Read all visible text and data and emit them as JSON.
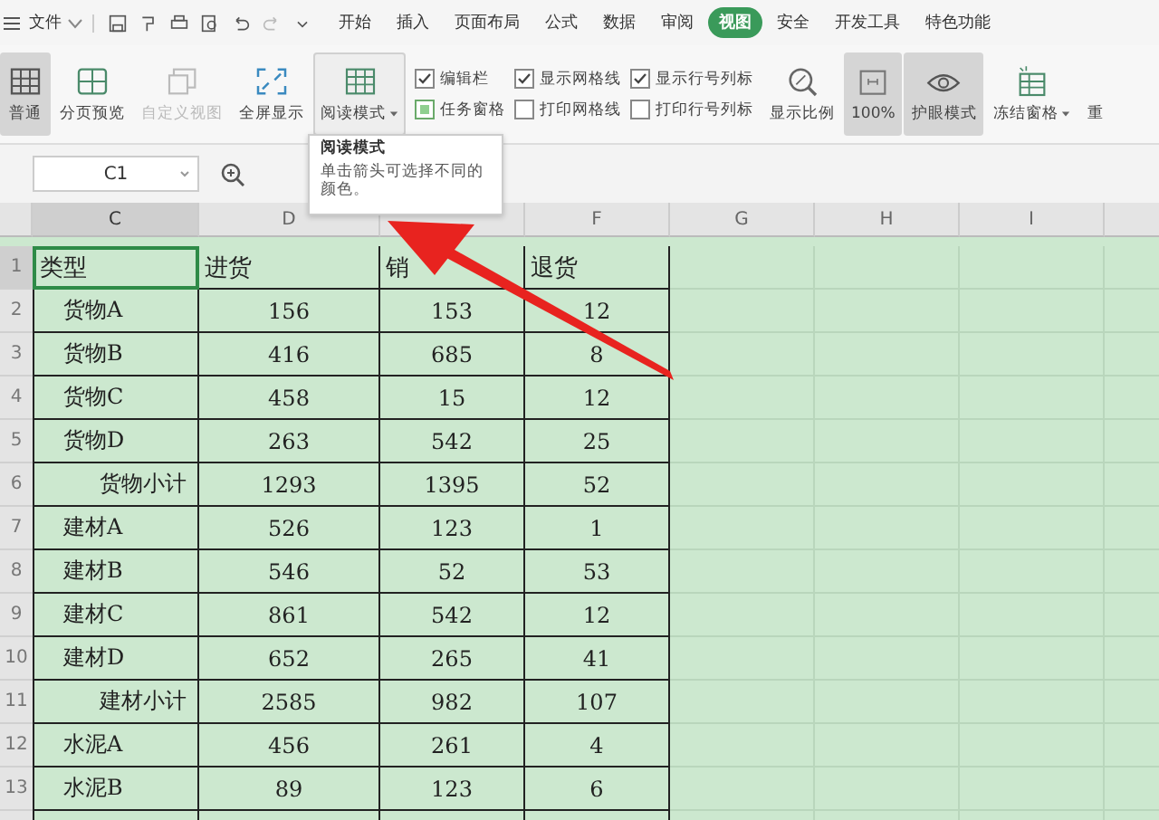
{
  "menu_bar": {
    "file_menu": "文件",
    "tabs": [
      {
        "label": "开始",
        "selected": false
      },
      {
        "label": "插入",
        "selected": false
      },
      {
        "label": "页面布局",
        "selected": false
      },
      {
        "label": "公式",
        "selected": false
      },
      {
        "label": "数据",
        "selected": false
      },
      {
        "label": "审阅",
        "selected": false
      },
      {
        "label": "视图",
        "selected": true
      },
      {
        "label": "安全",
        "selected": false
      },
      {
        "label": "开发工具",
        "selected": false
      },
      {
        "label": "特色功能",
        "selected": false
      }
    ]
  },
  "ribbon": {
    "view_buttons": [
      {
        "label": "普通",
        "selected": true,
        "disabled": false,
        "dropdown": false,
        "hovered": false
      },
      {
        "label": "分页预览",
        "selected": false,
        "disabled": false,
        "dropdown": false,
        "hovered": false
      },
      {
        "label": "自定义视图",
        "selected": false,
        "disabled": true,
        "dropdown": false,
        "hovered": false
      },
      {
        "label": "全屏显示",
        "selected": false,
        "disabled": false,
        "dropdown": false,
        "hovered": false
      },
      {
        "label": "阅读模式",
        "selected": false,
        "disabled": false,
        "dropdown": true,
        "hovered": true
      }
    ],
    "checkboxes": [
      {
        "label": "编辑栏",
        "kind": "tick",
        "checked": true
      },
      {
        "label": "任务窗格",
        "kind": "square",
        "checked": true
      },
      {
        "label": "显示网格线",
        "kind": "tick",
        "checked": true
      },
      {
        "label": "打印网格线",
        "kind": "tick",
        "checked": false
      },
      {
        "label": "显示行号列标",
        "kind": "tick",
        "checked": true
      },
      {
        "label": "打印行号列标",
        "kind": "tick",
        "checked": false
      }
    ],
    "tool_buttons": [
      {
        "label": "显示比例",
        "selected": false,
        "dropdown": false
      },
      {
        "label": "100%",
        "selected": true,
        "dropdown": false
      },
      {
        "label": "护眼模式",
        "selected": true,
        "dropdown": false
      },
      {
        "label": "冻结窗格",
        "selected": false,
        "dropdown": true
      },
      {
        "label": "重",
        "selected": false,
        "dropdown": false
      }
    ]
  },
  "formula_bar": {
    "name_box": "C1"
  },
  "tooltip": {
    "title": "阅读模式",
    "text": "单击箭头可选择不同的颜色。"
  },
  "sheet": {
    "columns": [
      {
        "label": "C",
        "selected": true
      },
      {
        "label": "D",
        "selected": false
      },
      {},
      {
        "label": "F",
        "selected": false
      },
      {
        "label": "G",
        "selected": false
      },
      {
        "label": "H",
        "selected": false
      },
      {
        "label": "I",
        "selected": false
      },
      {}
    ],
    "rows": [
      {
        "number": "1",
        "kind": "header",
        "selected": true,
        "cells": [
          "类型",
          "进货",
          "销",
          "退货"
        ]
      },
      {
        "number": "2",
        "kind": "item",
        "selected": false,
        "cells": [
          "货物A",
          "156",
          "153",
          "12"
        ]
      },
      {
        "number": "3",
        "kind": "item",
        "selected": false,
        "cells": [
          "货物B",
          "416",
          "685",
          "8"
        ]
      },
      {
        "number": "4",
        "kind": "item",
        "selected": false,
        "cells": [
          "货物C",
          "458",
          "15",
          "12"
        ]
      },
      {
        "number": "5",
        "kind": "item",
        "selected": false,
        "cells": [
          "货物D",
          "263",
          "542",
          "25"
        ]
      },
      {
        "number": "6",
        "kind": "subtotal",
        "selected": false,
        "cells": [
          "货物小计",
          "1293",
          "1395",
          "52"
        ]
      },
      {
        "number": "7",
        "kind": "item",
        "selected": false,
        "cells": [
          "建材A",
          "526",
          "123",
          "1"
        ]
      },
      {
        "number": "8",
        "kind": "item",
        "selected": false,
        "cells": [
          "建材B",
          "546",
          "52",
          "53"
        ]
      },
      {
        "number": "9",
        "kind": "item",
        "selected": false,
        "cells": [
          "建材C",
          "861",
          "542",
          "12"
        ]
      },
      {
        "number": "10",
        "kind": "item",
        "selected": false,
        "cells": [
          "建材D",
          "652",
          "265",
          "41"
        ]
      },
      {
        "number": "11",
        "kind": "subtotal",
        "selected": false,
        "cells": [
          "建材小计",
          "2585",
          "982",
          "107"
        ]
      },
      {
        "number": "12",
        "kind": "item",
        "selected": false,
        "cells": [
          "水泥A",
          "456",
          "261",
          "4"
        ]
      },
      {
        "number": "13",
        "kind": "item",
        "selected": false,
        "cells": [
          "水泥B",
          "89",
          "123",
          "6"
        ]
      }
    ]
  }
}
